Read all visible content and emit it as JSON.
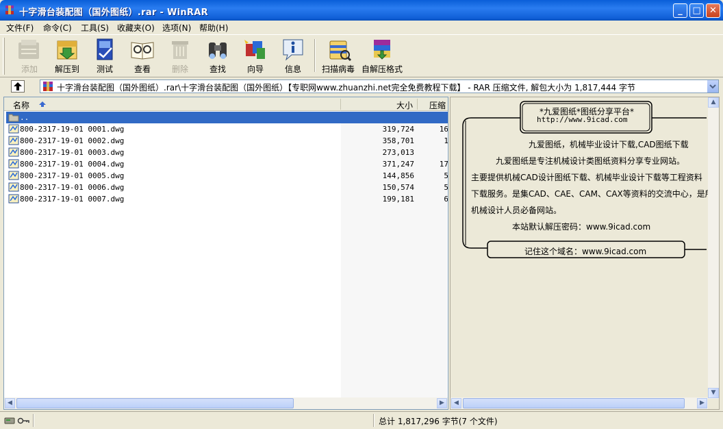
{
  "window": {
    "title": "十字滑台装配图（国外图纸）.rar - WinRAR"
  },
  "menu": [
    {
      "label": "文件(F)"
    },
    {
      "label": "命令(C)"
    },
    {
      "label": "工具(S)"
    },
    {
      "label": "收藏夹(O)"
    },
    {
      "label": "选项(N)"
    },
    {
      "label": "帮助(H)"
    }
  ],
  "toolbar": [
    {
      "label": "添加",
      "icon": "add-icon",
      "disabled": true
    },
    {
      "label": "解压到",
      "icon": "extract-to-icon",
      "disabled": false
    },
    {
      "label": "测试",
      "icon": "test-icon",
      "disabled": false
    },
    {
      "label": "查看",
      "icon": "view-icon",
      "disabled": false
    },
    {
      "label": "删除",
      "icon": "delete-icon",
      "disabled": true
    },
    {
      "label": "查找",
      "icon": "find-icon",
      "disabled": false
    },
    {
      "label": "向导",
      "icon": "wizard-icon",
      "disabled": false
    },
    {
      "label": "信息",
      "icon": "info-icon",
      "disabled": false
    },
    {
      "label": "扫描病毒",
      "icon": "scan-virus-icon",
      "disabled": false
    },
    {
      "label": "自解压格式",
      "icon": "sfx-icon",
      "disabled": false
    }
  ],
  "address": {
    "path": "十字滑台装配图（国外图纸）.rar\\十字滑台装配图（国外图纸）【专职网www.zhuanzhi.net完全免费教程下载】 - RAR 压缩文件, 解包大小为 1,817,444 字节"
  },
  "columns": {
    "name": "名称",
    "size": "大小",
    "packed": "压缩"
  },
  "files": [
    {
      "name": "..",
      "size": "",
      "packed": "",
      "selected": true,
      "type": "folder-up"
    },
    {
      "name": "800-2317-19-01 0001.dwg",
      "size": "319,724",
      "packed": "16",
      "selected": false,
      "type": "dwg"
    },
    {
      "name": "800-2317-19-01 0002.dwg",
      "size": "358,701",
      "packed": "1",
      "selected": false,
      "type": "dwg"
    },
    {
      "name": "800-2317-19-01 0003.dwg",
      "size": "273,013",
      "packed": "",
      "selected": false,
      "type": "dwg"
    },
    {
      "name": "800-2317-19-01 0004.dwg",
      "size": "371,247",
      "packed": "17",
      "selected": false,
      "type": "dwg"
    },
    {
      "name": "800-2317-19-01 0005.dwg",
      "size": "144,856",
      "packed": "5",
      "selected": false,
      "type": "dwg"
    },
    {
      "name": "800-2317-19-01 0006.dwg",
      "size": "150,574",
      "packed": "5",
      "selected": false,
      "type": "dwg"
    },
    {
      "name": "800-2317-19-01 0007.dwg",
      "size": "199,181",
      "packed": "6",
      "selected": false,
      "type": "dwg"
    }
  ],
  "comment": {
    "box_title": "*九爱图纸*图纸分享平台*",
    "box_url": "http://www.9icad.com",
    "line1": "九爱图纸，机械毕业设计下载,CAD图纸下载",
    "line2": "九爱图纸是专注机械设计类图纸资料分享专业网站。",
    "line3": "主要提供机械CAD设计图纸下载、机械毕业设计下载等工程资料",
    "line4": "下载服务。是集CAD、CAE、CAM、CAX等资料的交流中心，是所有",
    "line5": "机械设计人员必备网站。",
    "line6": "本站默认解压密码：www.9icad.com",
    "footer": "记住这个域名：www.9icad.com"
  },
  "status": {
    "total": "总计 1,817,296 字节(7 个文件)"
  },
  "colors": {
    "titlebar": "#0a5fd8",
    "selection": "#316ac5",
    "window_bg": "#ece9d8"
  }
}
